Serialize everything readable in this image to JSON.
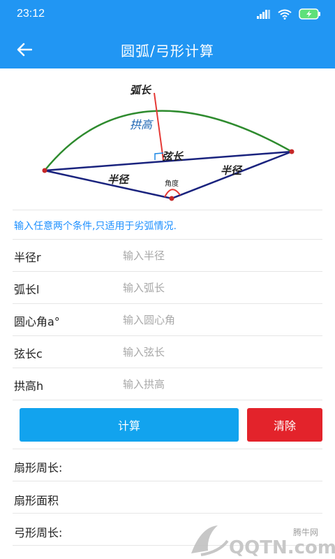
{
  "status_bar": {
    "time": "23:12",
    "icons": [
      "signal-icon",
      "wifi-icon",
      "battery-charging-icon"
    ]
  },
  "toolbar": {
    "title": "圆弧/弓形计算",
    "back_icon": "arrow-left-icon"
  },
  "diagram": {
    "labels": {
      "arc_length": "弧长",
      "arch_height": "拱高",
      "chord": "弦长",
      "radius_left": "半径",
      "radius_right": "半径",
      "angle": "角度"
    },
    "colors": {
      "arc": "#2e8b2e",
      "chord": "#1a237e",
      "height": "#e53935",
      "angle": "#e53935",
      "point": "#c62828"
    }
  },
  "hint": "输入任意两个条件,只适用于劣弧情况.",
  "inputs": [
    {
      "label": "半径r",
      "placeholder": "输入半径",
      "value": ""
    },
    {
      "label": "弧长l",
      "placeholder": "输入弧长",
      "value": ""
    },
    {
      "label": "圆心角a°",
      "placeholder": "输入圆心角",
      "value": ""
    },
    {
      "label": "弦长c",
      "placeholder": "输入弦长",
      "value": ""
    },
    {
      "label": "拱高h",
      "placeholder": "输入拱高",
      "value": ""
    }
  ],
  "buttons": {
    "calculate": "计算",
    "clear": "清除"
  },
  "results": [
    {
      "label": "扇形周长:"
    },
    {
      "label": "扇形面积"
    },
    {
      "label": "弓形周长:"
    }
  ],
  "watermark": {
    "site": "腾牛网",
    "logo_text": "QQTN.com"
  },
  "colors": {
    "primary": "#2196f3",
    "calc_button": "#12a3ee",
    "clear_button": "#e3232b",
    "hint_text": "#1e90ff"
  }
}
